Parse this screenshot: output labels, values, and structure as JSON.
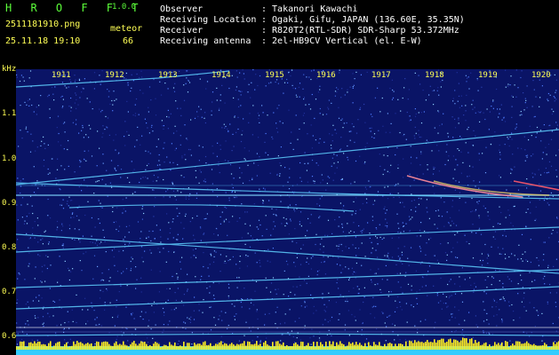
{
  "header": {
    "app_name": "H R O F F T",
    "version": "1.0.0",
    "filename": "2511181910.png",
    "datetime": "25.11.18 19:10",
    "meteor_label": "meteor",
    "meteor_count": "66",
    "observer_label": "Observer",
    "observer_value": ": Takanori Kawachi",
    "location_label": "Receiving Location",
    "location_value": ": Ogaki, Gifu, JAPAN (136.60E, 35.35N)",
    "receiver_label": "Receiver",
    "receiver_value": ": R820T2(RTL-SDR) SDR-Sharp 53.372MHz",
    "antenna_label": "Receiving antenna",
    "antenna_value": ": 2el-HB9CV Vertical (el. E-W)"
  },
  "plot": {
    "y_unit": "kHz",
    "y_ticks": [
      "1.1",
      "1.0",
      "0.9",
      "0.8",
      "0.7",
      "0.6"
    ],
    "x_ticks": [
      "1911",
      "1912",
      "1913",
      "1914",
      "1915",
      "1916",
      "1917",
      "1918",
      "1919",
      "1920"
    ],
    "colors": {
      "background": "#0a1466",
      "trace": "#5fd0ff",
      "bar": "#ffee22",
      "baseline": "#33ccff"
    }
  }
}
